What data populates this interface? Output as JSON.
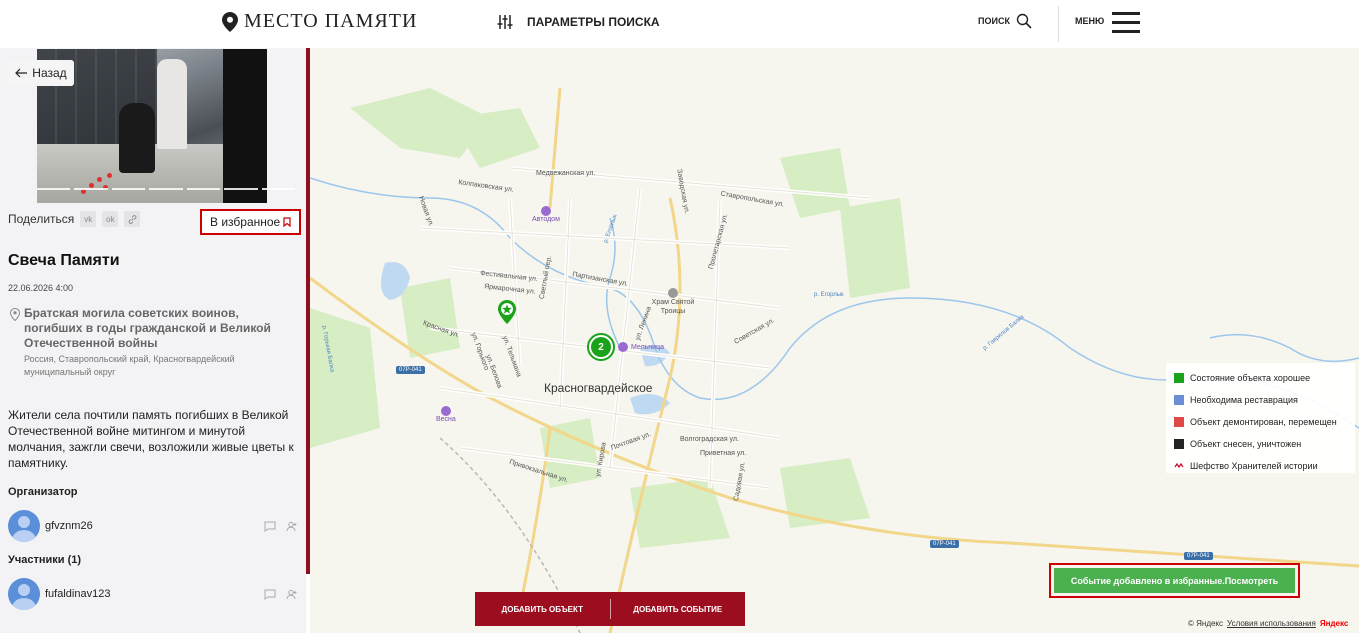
{
  "header": {
    "logo_text": "МЕСТО ПАМЯТИ",
    "params_label": "ПАРАМЕТРЫ ПОИСКА",
    "search_label": "ПОИСК",
    "menu_label": "МЕНЮ"
  },
  "sidebar": {
    "back_label": "Назад",
    "share_label": "Поделиться",
    "share_buttons": [
      "vk",
      "ok",
      "link"
    ],
    "favorite_label": "В избранное",
    "event_title": "Свеча Памяти",
    "event_date": "22.06.2026 4:00",
    "place_name": "Братская могила советских воинов, погибших в годы гражданской и Великой Отечественной войны",
    "place_region": "Россия, Ставропольский край, Красногвардейский муниципальный округ",
    "description": "Жители села почтили память погибших в Великой Отечественной войне митингом и минутой молчания, зажгли свечи, возложили живые цветы к памятнику.",
    "organizer_heading": "Организатор",
    "organizer": "gfvznm26",
    "participants_heading": "Участники (1)",
    "participants": [
      "fufaldinav123"
    ]
  },
  "map": {
    "city_label": "Красногвардейское",
    "cluster_count": "2",
    "streets": [
      "Медвежанская ул.",
      "Колпаковская ул.",
      "Ставропольская ул.",
      "Партизанская ул.",
      "Фестивальная ул.",
      "Ярмарочная ул.",
      "Красная ул.",
      "ул. Горького",
      "Привокзальная ул.",
      "Волгоградская ул.",
      "Приветная ул.",
      "Советская ул.",
      "Заводская ул.",
      "Пролетарская ул.",
      "ул. Ленина",
      "ул. Тельмана",
      "ул. Белова",
      "ул. Кирова",
      "Светлый пер.",
      "Почтовая ул.",
      "Садовая ул.",
      "Новая ул."
    ],
    "pois": [
      "Автодом",
      "Храм Святой Троицы",
      "Мельница",
      "Весна"
    ],
    "road_badges": [
      "07Р-041",
      "07Р-041",
      "07Р-041"
    ],
    "rivers": [
      "р. Горькая Балка",
      "р. Егорлык",
      "р. Егорлык",
      "р. Гаврилов Балка"
    ]
  },
  "legend": [
    {
      "label": "Состояние объекта хорошее",
      "color": "#1aa31a"
    },
    {
      "label": "Необходима реставрация",
      "color": "#6b8fd6"
    },
    {
      "label": "Объект демонтирован, перемещен",
      "color": "#e04848"
    },
    {
      "label": "Объект снесен, уничтожен",
      "color": "#222222"
    },
    {
      "label": "Шефство Хранителей истории",
      "color": "#c8102e"
    }
  ],
  "actions": {
    "add_object": "ДОБАВИТЬ ОБЪЕКТ",
    "add_event": "ДОБАВИТЬ СОБЫТИЕ"
  },
  "toast": "Событие добавлено в избранные.Посмотреть",
  "attribution": {
    "copyright": "© Яндекс",
    "terms": "Условия использования",
    "brand": "Яндекс"
  }
}
